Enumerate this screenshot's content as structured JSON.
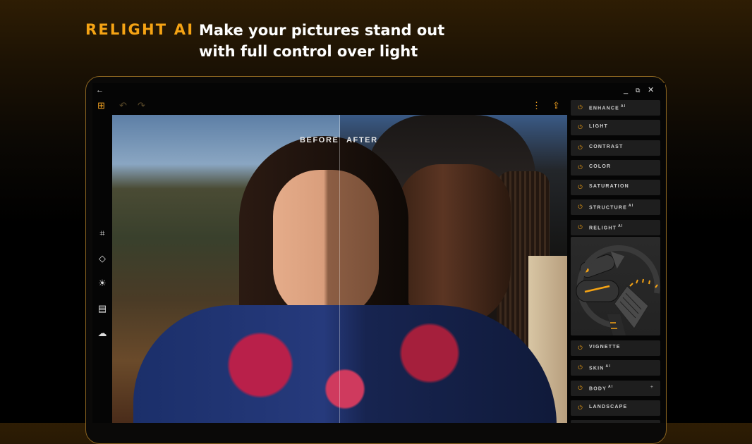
{
  "header": {
    "brand": "RELIGHT AI",
    "headline_line1": "Make your pictures stand out",
    "headline_line2": "with full control over light"
  },
  "compare": {
    "before_label": "BEFORE",
    "after_label": "AFTER"
  },
  "panel": {
    "items": [
      {
        "label": "ENHANCE",
        "ai": "AI"
      },
      {
        "label": "LIGHT",
        "ai": ""
      },
      {
        "label": "CONTRAST",
        "ai": ""
      },
      {
        "label": "COLOR",
        "ai": ""
      },
      {
        "label": "SATURATION",
        "ai": ""
      },
      {
        "label": "STRUCTURE",
        "ai": "AI"
      },
      {
        "label": "RELIGHT",
        "ai": "AI"
      },
      {
        "label": "VIGNETTE",
        "ai": ""
      },
      {
        "label": "SKIN",
        "ai": "AI"
      },
      {
        "label": "BODY",
        "ai": "AI",
        "extra": "+"
      },
      {
        "label": "LANDSCAPE",
        "ai": ""
      }
    ]
  },
  "colors": {
    "accent": "#f5a314",
    "panel_item_bg": "#1e1e1e",
    "device_border": "#8a6420"
  },
  "icons": {
    "back": "arrow-left-icon",
    "grid": "grid-icon",
    "undo": "undo-icon",
    "redo": "redo-icon",
    "more": "more-vertical-icon",
    "share": "share-icon",
    "tools": [
      "crop-icon",
      "eraser-icon",
      "brightness-icon",
      "layers-icon",
      "weather-icon"
    ]
  }
}
